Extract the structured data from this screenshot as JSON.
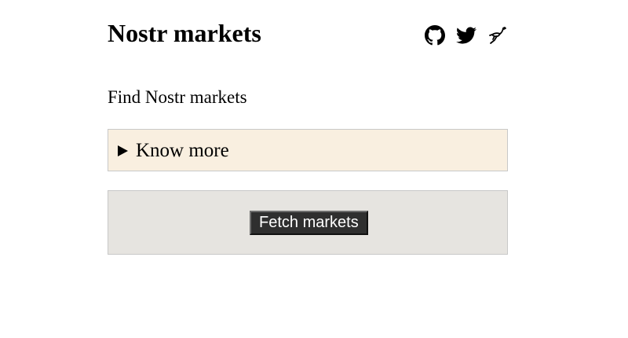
{
  "header": {
    "title": "Nostr markets",
    "social_links": [
      {
        "icon": "github-icon"
      },
      {
        "icon": "twitter-icon"
      },
      {
        "icon": "nostr-ostrich-icon"
      }
    ]
  },
  "main": {
    "subtitle": "Find Nostr markets",
    "details": {
      "summary_label": "Know more",
      "background_color": "#f9efe0"
    },
    "fetch": {
      "button_label": "Fetch markets",
      "panel_color": "#e6e4e0",
      "button_color": "#2f2f2f"
    }
  }
}
